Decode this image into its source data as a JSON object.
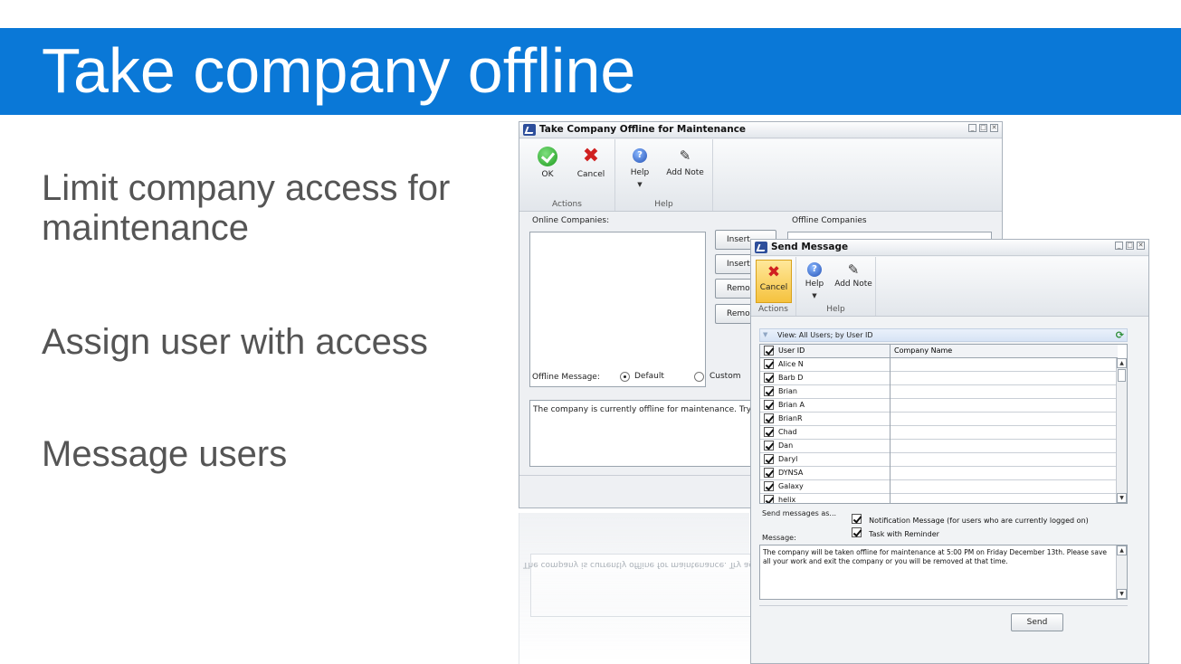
{
  "slide": {
    "title": "Take company offline",
    "bullets": [
      "Limit company access for maintenance",
      "Assign user with access",
      "Message users"
    ]
  },
  "offline_dialog": {
    "title": "Take Company Offline for Maintenance",
    "window_buttons": [
      "_",
      "□",
      "✕"
    ],
    "ribbon": {
      "actions_group": "Actions",
      "help_group": "Help",
      "ok_label": "OK",
      "cancel_label": "Cancel",
      "help_label": "Help",
      "add_note_label": "Add Note"
    },
    "online_companies_label": "Online Companies:",
    "offline_companies_label": "Offline Companies",
    "insert_buttons": [
      "Insert",
      "Insert",
      "Remo",
      "Remov"
    ],
    "offline_message_label": "Offline Message:",
    "radio_default": "Default",
    "radio_custom": "Custom",
    "selected_radio": "Default",
    "message_text": "The company is currently offline for maintenance. Try ag",
    "reflected_text": "The company is currently offline for maintenance. Try ag"
  },
  "send_dialog": {
    "title": "Send Message",
    "window_buttons": [
      "_",
      "□",
      "✕"
    ],
    "ribbon": {
      "actions_group": "Actions",
      "help_group": "Help",
      "cancel_label": "Cancel",
      "help_label": "Help",
      "add_note_label": "Add Note"
    },
    "view_label": "View: All Users; by User ID",
    "grid": {
      "columns": [
        "User ID",
        "Company Name"
      ],
      "rows": [
        {
          "user_id": "Alice N",
          "company": "",
          "checked": true
        },
        {
          "user_id": "Barb D",
          "company": "",
          "checked": true
        },
        {
          "user_id": "Brian",
          "company": "",
          "checked": true
        },
        {
          "user_id": "Brian A",
          "company": "",
          "checked": true
        },
        {
          "user_id": "BrianR",
          "company": "",
          "checked": true
        },
        {
          "user_id": "Chad",
          "company": "",
          "checked": true
        },
        {
          "user_id": "Dan",
          "company": "",
          "checked": true
        },
        {
          "user_id": "Daryl",
          "company": "",
          "checked": true
        },
        {
          "user_id": "DYNSA",
          "company": "",
          "checked": true
        },
        {
          "user_id": "Galaxy",
          "company": "",
          "checked": true
        },
        {
          "user_id": "helix",
          "company": "",
          "checked": true
        }
      ]
    },
    "send_as_label": "Send messages as...",
    "send_options": [
      {
        "label": "Notification Message (for users who are currently logged on)",
        "checked": true
      },
      {
        "label": "Task with Reminder",
        "checked": true
      }
    ],
    "message_label": "Message:",
    "message_text": "The company will be taken offline for maintenance at 5:00 PM on Friday December 13th. Please save all your work and exit the company or you will be removed at that time.",
    "send_button": "Send"
  }
}
